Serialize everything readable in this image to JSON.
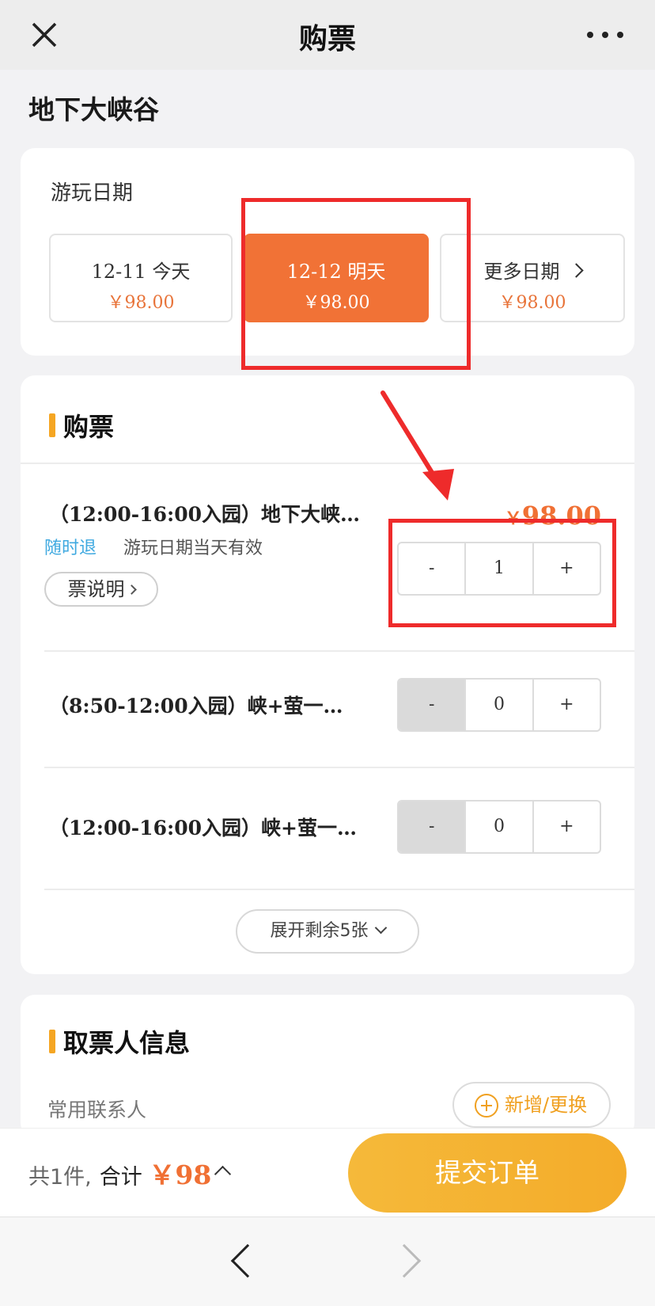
{
  "navbar": {
    "title": "购票",
    "close_icon": "close-icon",
    "more_icon": "more-icon"
  },
  "page_title": "地下大峡谷",
  "date_section": {
    "label": "游玩日期",
    "options": [
      {
        "date": "12-11  今天",
        "price": "￥98.00",
        "selected": false
      },
      {
        "date": "12-12  明天",
        "price": "￥98.00",
        "selected": true
      },
      {
        "date": "更多日期",
        "price": "￥98.00",
        "selected": false
      }
    ]
  },
  "tickets_section": {
    "title": "购票",
    "tickets": [
      {
        "name": "（12:00-16:00入园）地下大峡…",
        "price_symbol": "￥",
        "price": "98.00",
        "tag": "随时退",
        "validity": "游玩日期当天有效",
        "desc_button": "票说明",
        "quantity": "1"
      },
      {
        "name": "（8:50-12:00入园）峡+萤一…",
        "quantity": "0"
      },
      {
        "name": "（12:00-16:00入园）峡+萤一…",
        "quantity": "0"
      }
    ],
    "stepper": {
      "minus": "-",
      "plus": "+"
    },
    "expand_button": "展开剩余5张"
  },
  "contact_section": {
    "title": "取票人信息",
    "label": "常用联系人",
    "button": "新增/更换"
  },
  "bottom_bar": {
    "count_text": "共1件,",
    "total_label": "合计",
    "total_value": "￥98",
    "submit": "提交订单"
  },
  "colors": {
    "accent_orange": "#f17236",
    "submit_yellow": "#f5b93a",
    "annotation_red": "#ee2b2b",
    "tag_blue": "#3fa9e0"
  }
}
